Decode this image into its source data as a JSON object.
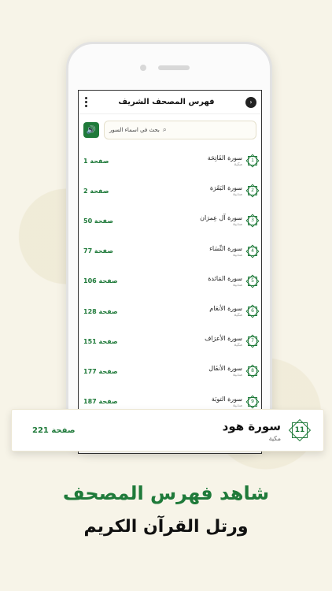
{
  "header": {
    "title": "فهرس المصحف الشريف"
  },
  "search": {
    "placeholder": "بحث في اسماء السور"
  },
  "surahs": [
    {
      "number": "1",
      "name": "سورة  الفَاتِحَة",
      "type": "مكية",
      "page": "صفحة 1"
    },
    {
      "number": "2",
      "name": "سورة  البَقَرَة",
      "type": "مدنية",
      "page": "صفحة 2"
    },
    {
      "number": "3",
      "name": "سورة  آل عِمرَان",
      "type": "مدنية",
      "page": "صفحة 50"
    },
    {
      "number": "4",
      "name": "سورة  النِّسَاء",
      "type": "مدنية",
      "page": "صفحة 77"
    },
    {
      "number": "5",
      "name": "سورة  المَائدة",
      "type": "مدنية",
      "page": "صفحة 106"
    },
    {
      "number": "6",
      "name": "سورة  الأنعَام",
      "type": "مكية",
      "page": "صفحة 128"
    },
    {
      "number": "7",
      "name": "سورة  الأعرَاف",
      "type": "مكية",
      "page": "صفحة 151"
    },
    {
      "number": "8",
      "name": "سورة  الأنفَال",
      "type": "مدنية",
      "page": "صفحة 177"
    },
    {
      "number": "9",
      "name": "سورة  التوبَة",
      "type": "مدنية",
      "page": "صفحة 187"
    }
  ],
  "popup": {
    "number": "11",
    "name": "سورة هود",
    "type": "مكية",
    "page": "صفحة 221"
  },
  "caption": {
    "line1": "شاهد فهرس المصحف",
    "line2": "ورتل القرآن الكريم"
  },
  "colors": {
    "accent": "#1f7a3a",
    "background": "#f7f4e8"
  },
  "icons": {
    "menu": "vertical-dots-icon",
    "nav": "chevron-right-icon",
    "sound": "speaker-icon",
    "search": "search-icon",
    "badge": "octagram-number-icon"
  }
}
